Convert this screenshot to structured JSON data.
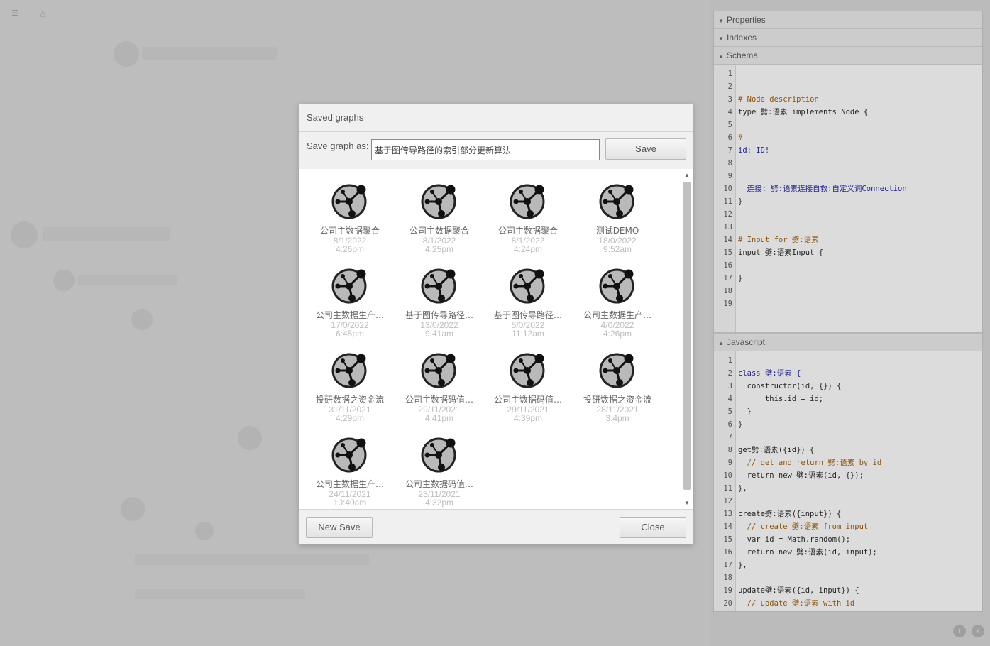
{
  "panel": {
    "sections": [
      {
        "label": "Properties",
        "state": "collapsed"
      },
      {
        "label": "Indexes",
        "state": "collapsed"
      },
      {
        "label": "Schema",
        "state": "expanded"
      },
      {
        "label": "Javascript",
        "state": "expanded"
      }
    ],
    "schema_lines": [
      {
        "n": "1",
        "t": "",
        "c": ""
      },
      {
        "n": "2",
        "t": "",
        "c": ""
      },
      {
        "n": "3",
        "t": "# Node description",
        "c": "comment"
      },
      {
        "n": "4",
        "t": "type 劈:语素 implements Node {",
        "c": ""
      },
      {
        "n": "5",
        "t": "",
        "c": ""
      },
      {
        "n": "6",
        "t": "#",
        "c": "comment"
      },
      {
        "n": "7",
        "t": "id: ID!",
        "c": "kw"
      },
      {
        "n": "8",
        "t": "",
        "c": ""
      },
      {
        "n": "9",
        "t": "",
        "c": ""
      },
      {
        "n": "10",
        "t": "  连接: 劈:语素连接自救:自定义词Connection",
        "c": "kw"
      },
      {
        "n": "11",
        "t": "}",
        "c": ""
      },
      {
        "n": "12",
        "t": "",
        "c": ""
      },
      {
        "n": "13",
        "t": "",
        "c": ""
      },
      {
        "n": "14",
        "t": "# Input for 劈:语素",
        "c": "comment"
      },
      {
        "n": "15",
        "t": "input 劈:语素Input {",
        "c": ""
      },
      {
        "n": "16",
        "t": "",
        "c": ""
      },
      {
        "n": "17",
        "t": "}",
        "c": ""
      },
      {
        "n": "18",
        "t": "",
        "c": ""
      },
      {
        "n": "19",
        "t": "",
        "c": ""
      }
    ],
    "js_lines": [
      {
        "n": "1",
        "t": "",
        "c": ""
      },
      {
        "n": "2",
        "t": "class 劈:语素 {",
        "c": "kw"
      },
      {
        "n": "3",
        "t": "  constructor(id, {}) {",
        "c": ""
      },
      {
        "n": "4",
        "t": "      this.id = id;",
        "c": ""
      },
      {
        "n": "5",
        "t": "  }",
        "c": ""
      },
      {
        "n": "6",
        "t": "}",
        "c": ""
      },
      {
        "n": "7",
        "t": "",
        "c": ""
      },
      {
        "n": "8",
        "t": "get劈:语素({id}) {",
        "c": ""
      },
      {
        "n": "9",
        "t": "  // get and return 劈:语素 by id",
        "c": "comment"
      },
      {
        "n": "10",
        "t": "  return new 劈:语素(id, {});",
        "c": ""
      },
      {
        "n": "11",
        "t": "},",
        "c": ""
      },
      {
        "n": "12",
        "t": "",
        "c": ""
      },
      {
        "n": "13",
        "t": "create劈:语素({input}) {",
        "c": ""
      },
      {
        "n": "14",
        "t": "  // create 劈:语素 from input",
        "c": "comment"
      },
      {
        "n": "15",
        "t": "  var id = Math.random();",
        "c": ""
      },
      {
        "n": "16",
        "t": "  return new 劈:语素(id, input);",
        "c": ""
      },
      {
        "n": "17",
        "t": "},",
        "c": ""
      },
      {
        "n": "18",
        "t": "",
        "c": ""
      },
      {
        "n": "19",
        "t": "update劈:语素({id, input}) {",
        "c": ""
      },
      {
        "n": "20",
        "t": "  // update 劈:语素 with id",
        "c": "comment"
      }
    ]
  },
  "dialog": {
    "title": "Saved graphs",
    "save_label": "Save graph as:",
    "save_value": "基于图传导路径的索引部分更新算法",
    "save_button": "Save",
    "new_save_button": "New Save",
    "close_button": "Close",
    "items": [
      {
        "name": "公司主数据聚合",
        "date": "8/1/2022",
        "time": "4:26pm"
      },
      {
        "name": "公司主数据聚合",
        "date": "8/1/2022",
        "time": "4:25pm"
      },
      {
        "name": "公司主数据聚合",
        "date": "8/1/2022",
        "time": "4:24pm"
      },
      {
        "name": "测试DEMO",
        "date": "18/0/2022",
        "time": "9:52am"
      },
      {
        "name": "公司主数据生产…",
        "date": "17/0/2022",
        "time": "6:45pm"
      },
      {
        "name": "基于图传导路径…",
        "date": "13/0/2022",
        "time": "9:41am"
      },
      {
        "name": "基于图传导路径…",
        "date": "5/0/2022",
        "time": "11:12am"
      },
      {
        "name": "公司主数据生产…",
        "date": "4/0/2022",
        "time": "4:26pm"
      },
      {
        "name": "投研数据之资金流",
        "date": "31/11/2021",
        "time": "4:29pm"
      },
      {
        "name": "公司主数据码值…",
        "date": "29/11/2021",
        "time": "4:41pm"
      },
      {
        "name": "公司主数据码值…",
        "date": "29/11/2021",
        "time": "4:39pm"
      },
      {
        "name": "投研数据之资金流",
        "date": "28/11/2021",
        "time": "3:4pm"
      },
      {
        "name": "公司主数据生产…",
        "date": "24/11/2021",
        "time": "10:40am"
      },
      {
        "name": "公司主数据码值…",
        "date": "23/11/2021",
        "time": "4:32pm"
      }
    ]
  },
  "footer_icons": [
    "info-icon",
    "help-icon"
  ]
}
